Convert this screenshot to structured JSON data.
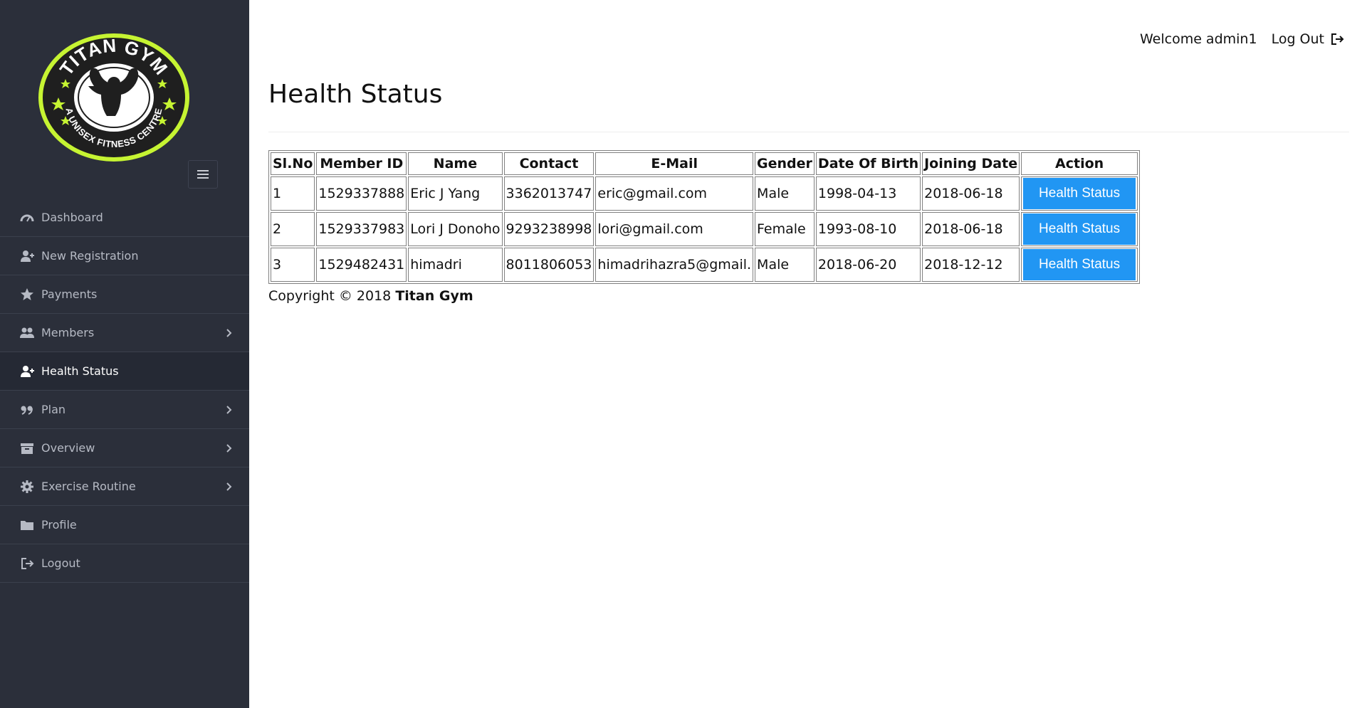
{
  "brand": {
    "logo_text_top": "TITAN GYM",
    "logo_text_bottom": "A UNISEX FITNESS CENTRE",
    "accent": "#c6f432",
    "sidebar_bg": "#2b2f3a"
  },
  "sidebar": {
    "items": [
      {
        "label": "Dashboard",
        "icon": "dashboard-icon",
        "has_children": false,
        "active": false
      },
      {
        "label": "New Registration",
        "icon": "user-plus-icon",
        "has_children": false,
        "active": false
      },
      {
        "label": "Payments",
        "icon": "star-icon",
        "has_children": false,
        "active": false
      },
      {
        "label": "Members",
        "icon": "users-icon",
        "has_children": true,
        "active": false
      },
      {
        "label": "Health Status",
        "icon": "user-plus-icon",
        "has_children": false,
        "active": true
      },
      {
        "label": "Plan",
        "icon": "quote-icon",
        "has_children": true,
        "active": false
      },
      {
        "label": "Overview",
        "icon": "archive-icon",
        "has_children": true,
        "active": false
      },
      {
        "label": "Exercise Routine",
        "icon": "gear-icon",
        "has_children": true,
        "active": false
      },
      {
        "label": "Profile",
        "icon": "folder-icon",
        "has_children": false,
        "active": false
      },
      {
        "label": "Logout",
        "icon": "sign-out-icon",
        "has_children": false,
        "active": false
      }
    ]
  },
  "header": {
    "welcome": "Welcome admin1",
    "logout_label": "Log Out"
  },
  "main": {
    "title": "Health Status",
    "table": {
      "columns": [
        "Sl.No",
        "Member ID",
        "Name",
        "Contact",
        "E-Mail",
        "Gender",
        "Date Of Birth",
        "Joining Date",
        "Action"
      ],
      "rows": [
        {
          "slno": "1",
          "member_id": "1529337888",
          "name": "Eric J Yang",
          "contact": "3362013747",
          "email": "eric@gmail.com",
          "gender": "Male",
          "dob": "1998-04-13",
          "joining": "2018-06-18",
          "action": "Health Status"
        },
        {
          "slno": "2",
          "member_id": "1529337983",
          "name": "Lori J Donoho",
          "contact": "9293238998",
          "email": "lori@gmail.com",
          "gender": "Female",
          "dob": "1993-08-10",
          "joining": "2018-06-18",
          "action": "Health Status"
        },
        {
          "slno": "3",
          "member_id": "1529482431",
          "name": "himadri",
          "contact": "8011806053",
          "email": "himadrihazra5@gmail.",
          "gender": "Male",
          "dob": "2018-06-20",
          "joining": "2018-12-12",
          "action": "Health Status"
        }
      ]
    },
    "button_color": "#2196f3"
  },
  "footer": {
    "copyright_prefix": "Copyright © 2018",
    "brand": "Titan Gym"
  }
}
